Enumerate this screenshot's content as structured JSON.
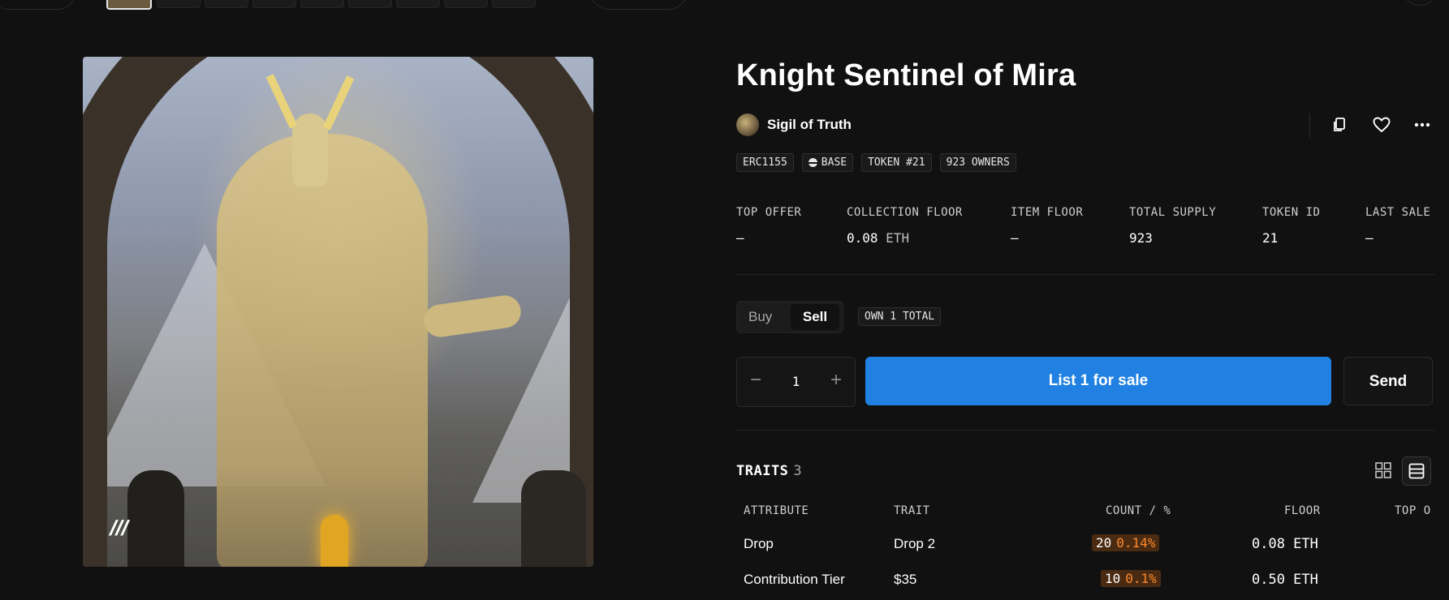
{
  "title": "Knight Sentinel of Mira",
  "collection": {
    "name": "Sigil of Truth"
  },
  "badges": [
    "ERC1155",
    "BASE",
    "TOKEN #21",
    "923 OWNERS"
  ],
  "stats": [
    {
      "label": "TOP OFFER",
      "value": "–",
      "unit": ""
    },
    {
      "label": "COLLECTION FLOOR",
      "value": "0.08",
      "unit": "ETH"
    },
    {
      "label": "ITEM FLOOR",
      "value": "–",
      "unit": ""
    },
    {
      "label": "TOTAL SUPPLY",
      "value": "923",
      "unit": ""
    },
    {
      "label": "TOKEN ID",
      "value": "21",
      "unit": ""
    },
    {
      "label": "LAST SALE",
      "value": "–",
      "unit": ""
    }
  ],
  "mode": {
    "buy": "Buy",
    "sell": "Sell",
    "own_badge": "OWN 1 TOTAL"
  },
  "stepper": {
    "minus": "−",
    "quantity": "1",
    "plus": "+"
  },
  "actions": {
    "list": "List 1 for sale",
    "send": "Send"
  },
  "traits": {
    "heading": "TRAITS",
    "count": "3",
    "columns": [
      "ATTRIBUTE",
      "TRAIT",
      "COUNT / %",
      "FLOOR",
      "TOP O"
    ],
    "rows": [
      {
        "attribute": "Drop",
        "trait": "Drop 2",
        "count": "20",
        "percent": "0.14%",
        "floor": "0.08 ETH"
      },
      {
        "attribute": "Contribution Tier",
        "trait": "$35",
        "count": "10",
        "percent": "0.1%",
        "floor": "0.50 ETH"
      }
    ]
  },
  "icons": {
    "copy": "copy-icon",
    "favorite": "heart-icon",
    "more": "more-icon",
    "grid_view": "grid-icon",
    "list_view": "list-icon"
  },
  "colors": {
    "accent": "#2081e2",
    "background": "#111111",
    "percent": "#ff8a2b"
  }
}
